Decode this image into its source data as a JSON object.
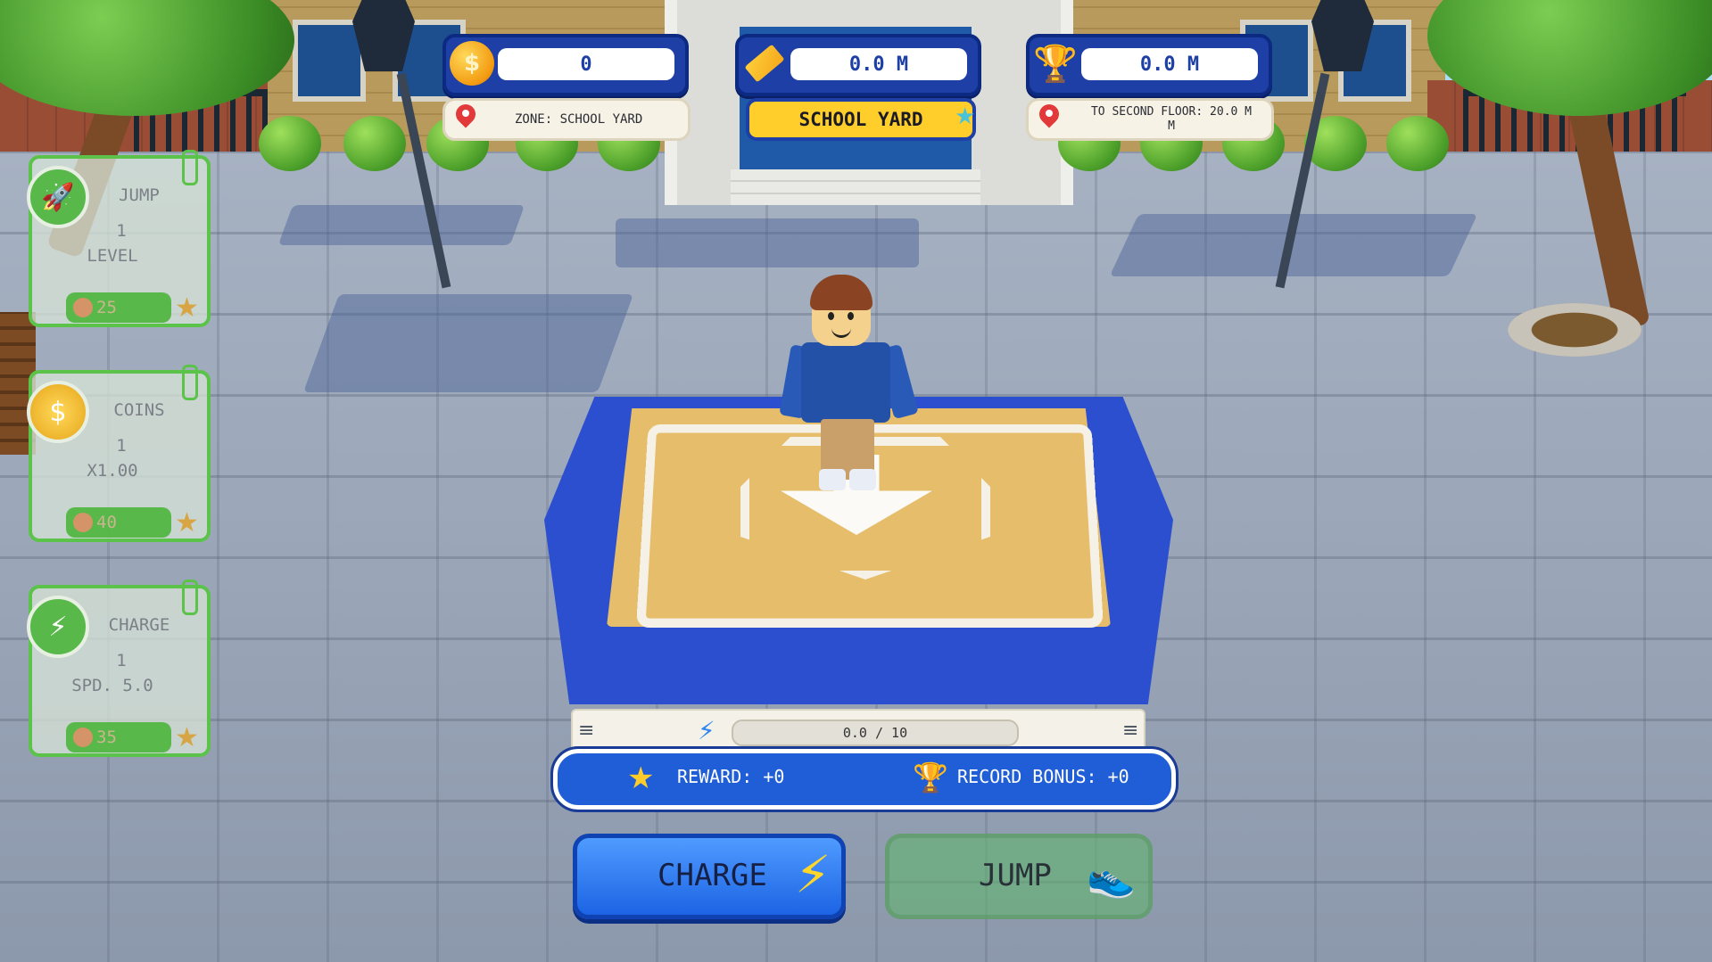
{
  "hud": {
    "coins": {
      "value": "0",
      "icon": "coin-icon"
    },
    "height": {
      "value": "0.0 M",
      "icon": "ruler-icon"
    },
    "record": {
      "value": "0.0 M",
      "icon": "trophy-icon"
    },
    "zone_label": "ZONE: SCHOOL YARD",
    "zone_banner": "SCHOOL YARD",
    "next_target": "TO SECOND FLOOR: 20.0 M\nM"
  },
  "upgrades": [
    {
      "id": "jump",
      "title": "JUMP",
      "level": "1",
      "detail": "LEVEL",
      "cost": "25",
      "icon": "rocket-icon"
    },
    {
      "id": "coins",
      "title": "COINS",
      "level": "1",
      "detail": "X1.00",
      "cost": "40",
      "icon": "coin-icon"
    },
    {
      "id": "charge",
      "title": "CHARGE",
      "level": "1",
      "detail": "SPD. 5.0",
      "cost": "35",
      "icon": "battery-icon"
    }
  ],
  "charge": {
    "progress_text": "0.0 / 10",
    "progress": 0.0
  },
  "rewards": {
    "reward": "REWARD: +0",
    "record_bonus": "RECORD BONUS: +0"
  },
  "buttons": {
    "charge": "CHARGE",
    "jump": "JUMP"
  },
  "colors": {
    "accent_blue": "#1f5ed6",
    "accent_yellow": "#ffce2b",
    "upgrade_green": "#58b84a"
  }
}
